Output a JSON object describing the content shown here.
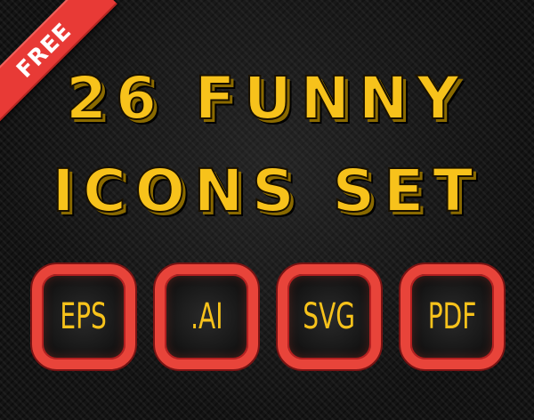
{
  "ribbon": {
    "label": "FREE",
    "color": "#e83a36"
  },
  "title": {
    "line1": "26 FUNNY",
    "line2": "ICONS SET",
    "color": "#f7c21b"
  },
  "formats": [
    {
      "label": "EPS"
    },
    {
      "label": ".AI"
    },
    {
      "label": "SVG"
    },
    {
      "label": "PDF"
    }
  ],
  "colors": {
    "background": "#141414",
    "badge_border": "#e8443a",
    "text": "#f7c21b"
  }
}
